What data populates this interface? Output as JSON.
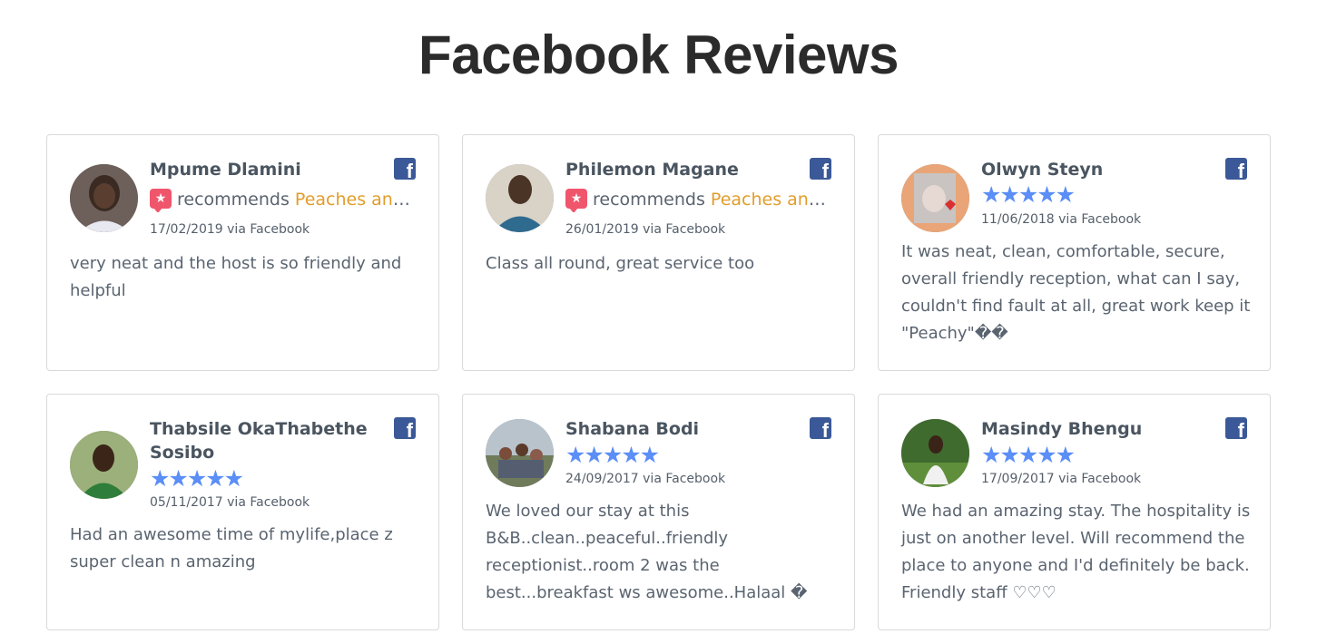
{
  "page": {
    "title": "Facebook Reviews"
  },
  "reviews": [
    {
      "name": "Mpume Dlamini",
      "recommends_label": "recommends",
      "place": "Peaches and Cream B&B",
      "date": "17/02/2019 via Facebook",
      "text": "very neat and the host is so friendly and helpful"
    },
    {
      "name": "Philemon Magane",
      "recommends_label": "recommends",
      "place": "Peaches and Cream B&B",
      "date": "26/01/2019 via Facebook",
      "text": "Class all round, great service too"
    },
    {
      "name": "Olwyn Steyn",
      "stars": "★★★★★",
      "rating": 5,
      "date": "11/06/2018 via Facebook",
      "text": "It was neat, clean, comfortable, secure, overall friendly reception, what can I say, couldn't find fault at all, great work keep it \"Peachy\"��"
    },
    {
      "name": "Thabsile OkaThabethe Sosibo",
      "stars": "★★★★★",
      "rating": 5,
      "date": "05/11/2017 via Facebook",
      "text": "Had an awesome time of mylife,place z super clean n amazing"
    },
    {
      "name": "Shabana Bodi",
      "stars": "★★★★★",
      "rating": 5,
      "date": "24/09/2017 via Facebook",
      "text": "We loved our stay at this B&B..clean..peaceful..friendly receptionist..room 2 was the best...breakfast ws awesome..Halaal �"
    },
    {
      "name": "Masindy Bhengu",
      "stars": "★★★★★",
      "rating": 5,
      "date": "17/09/2017 via Facebook",
      "text": "We had an amazing stay. The hospitality is just on another level. Will recommend the place to anyone and I'd definitely be back. Friendly staff ♡♡♡"
    }
  ],
  "icons": {
    "facebook": "facebook-icon",
    "recommend": "recommend-badge-icon",
    "star": "star-icon"
  },
  "colors": {
    "accent_link": "#e29d2b",
    "star": "#5b8ef6",
    "facebook": "#3b5998",
    "recommend_badge": "#f0566b"
  }
}
